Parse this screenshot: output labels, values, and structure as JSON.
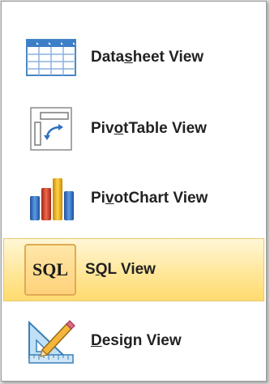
{
  "menu": {
    "items": [
      {
        "label_pre": "Data",
        "label_key": "s",
        "label_post": "heet View",
        "icon": "datasheet-grid-icon"
      },
      {
        "label_pre": "Piv",
        "label_key": "o",
        "label_post": "tTable View",
        "icon": "pivot-table-icon"
      },
      {
        "label_pre": "Pi",
        "label_key": "v",
        "label_post": "otChart View",
        "icon": "pivot-chart-icon"
      },
      {
        "label_pre": "S",
        "label_key": "Q",
        "label_post": "L View",
        "icon": "sql-icon",
        "icon_text": "SQL",
        "selected": true
      },
      {
        "label_pre": "",
        "label_key": "D",
        "label_post": "esign View",
        "icon": "design-ruler-pencil-icon"
      }
    ]
  },
  "colors": {
    "selected_bg": "#ffe79a",
    "selected_border": "#e8c873"
  }
}
